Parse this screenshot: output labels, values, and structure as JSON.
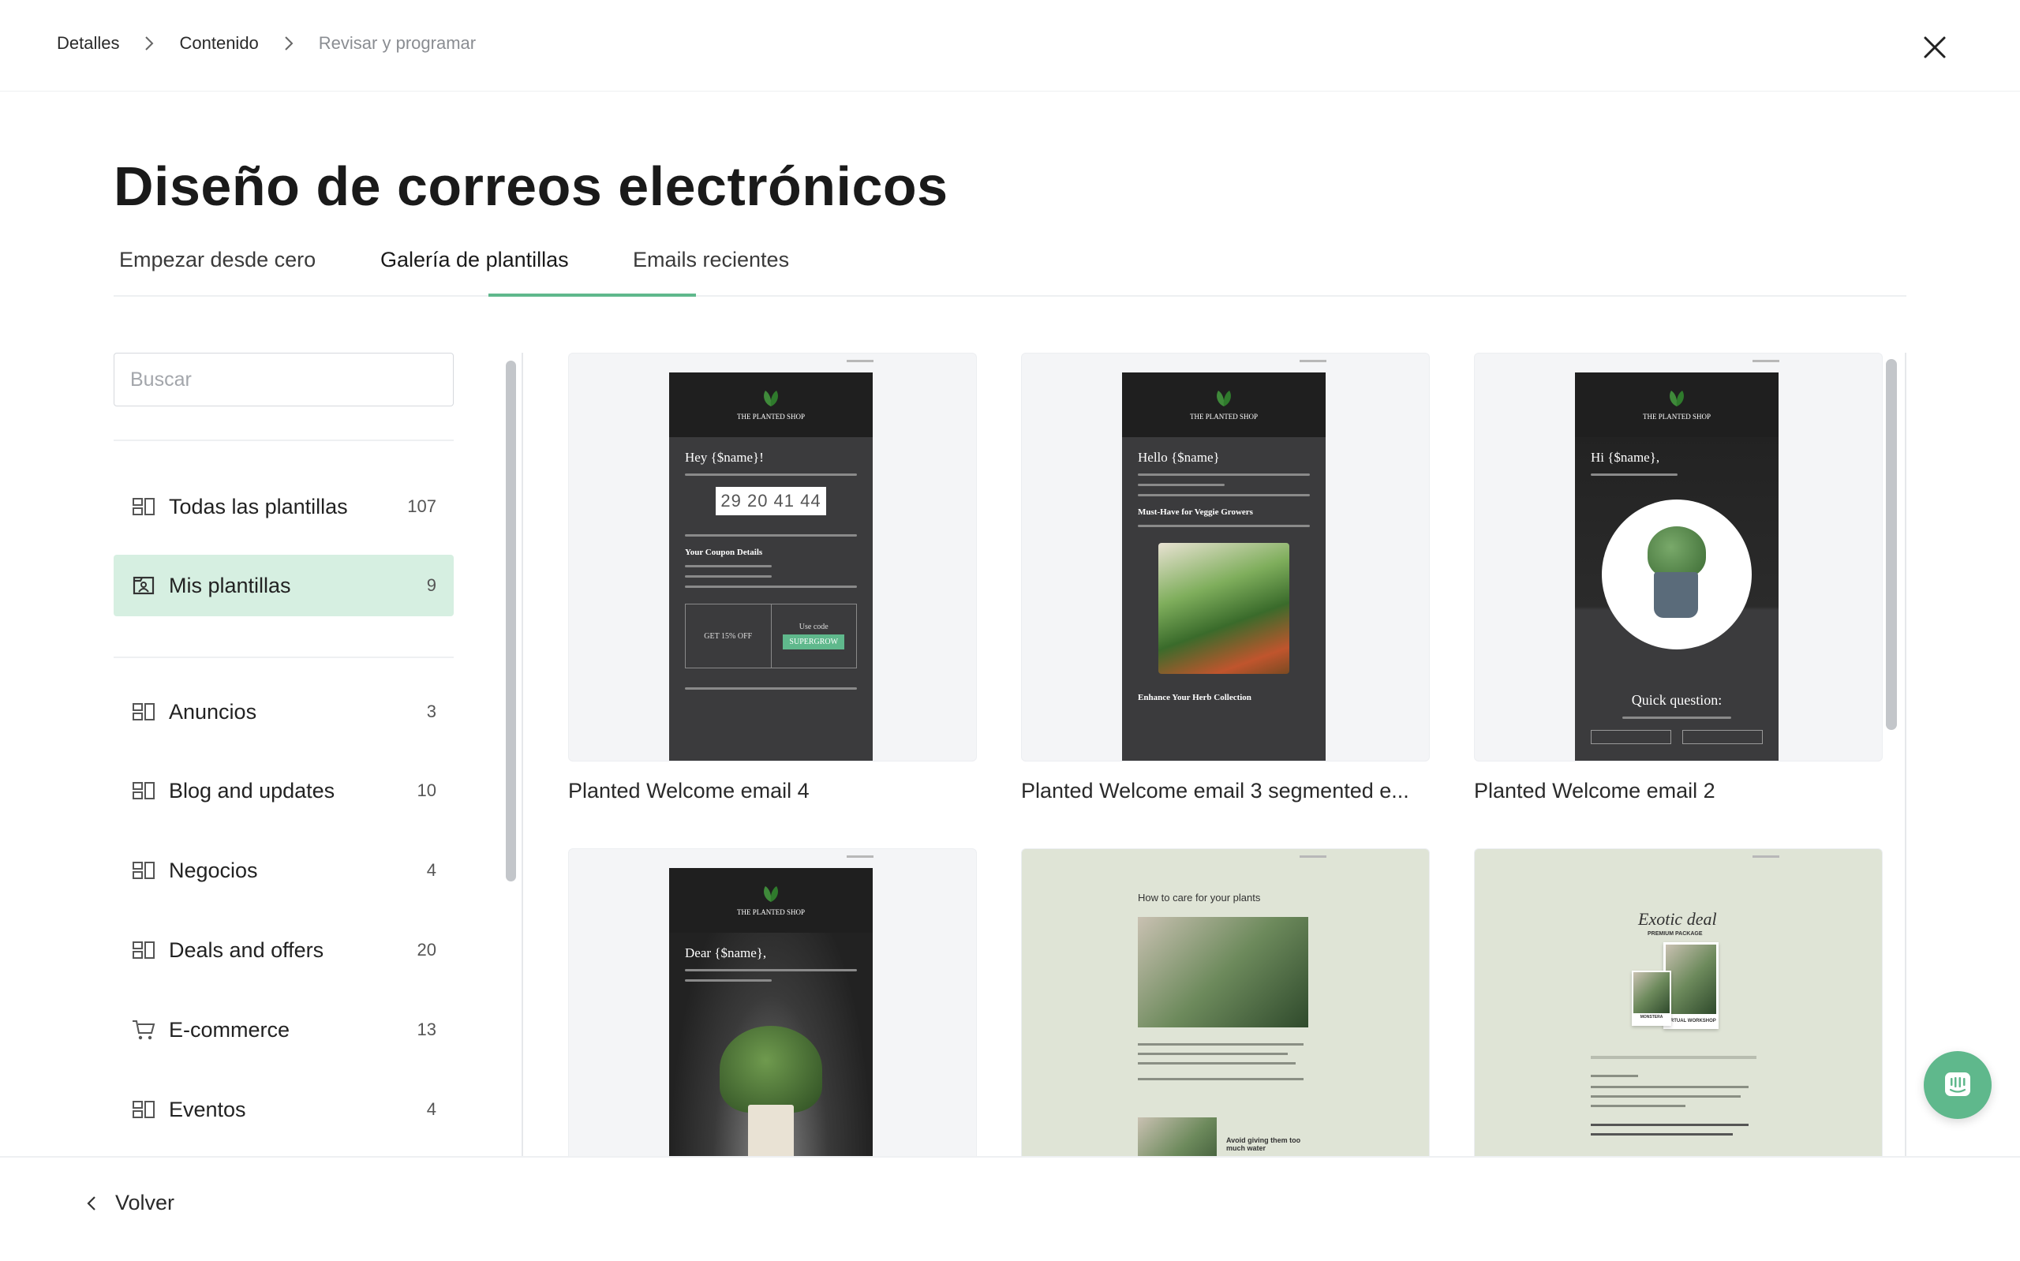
{
  "breadcrumb": {
    "step1": "Detalles",
    "step2": "Contenido",
    "step3": "Revisar y programar"
  },
  "page": {
    "title": "Diseño de correos electrónicos"
  },
  "tabs": [
    {
      "label": "Empezar desde cero",
      "active": false
    },
    {
      "label": "Galería de plantillas",
      "active": true
    },
    {
      "label": "Emails recientes",
      "active": false
    }
  ],
  "search": {
    "placeholder": "Buscar",
    "value": ""
  },
  "categories_primary": [
    {
      "label": "Todas las plantillas",
      "count": "107",
      "icon": "template-icon",
      "active": false
    },
    {
      "label": "Mis plantillas",
      "count": "9",
      "icon": "my-templates-icon",
      "active": true
    }
  ],
  "categories": [
    {
      "label": "Anuncios",
      "count": "3",
      "icon": "template-icon"
    },
    {
      "label": "Blog and updates",
      "count": "10",
      "icon": "template-icon"
    },
    {
      "label": "Negocios",
      "count": "4",
      "icon": "template-icon"
    },
    {
      "label": "Deals and offers",
      "count": "20",
      "icon": "template-icon"
    },
    {
      "label": "E-commerce",
      "count": "13",
      "icon": "cart-icon"
    },
    {
      "label": "Eventos",
      "count": "4",
      "icon": "template-icon"
    }
  ],
  "templates": [
    {
      "title": "Planted Welcome email 4",
      "preview": {
        "brand": "THE PLANTED SHOP",
        "greeting": "Hey {$name}!",
        "timer": "29 20 41 44",
        "section": "Your Coupon Details",
        "discount": "GET 15% OFF",
        "use_code": "Use code",
        "code": "SUPERGROW"
      }
    },
    {
      "title": "Planted Welcome email 3 segmented e...",
      "preview": {
        "brand": "THE PLANTED SHOP",
        "greeting": "Hello {$name}",
        "section": "Must-Have for Veggie Growers",
        "footer": "Enhance Your Herb Collection"
      }
    },
    {
      "title": "Planted Welcome email 2",
      "preview": {
        "brand": "THE PLANTED SHOP",
        "greeting": "Hi {$name},",
        "section": "Quick question:"
      }
    },
    {
      "title": "",
      "preview": {
        "brand": "THE PLANTED SHOP",
        "greeting": "Dear {$name},"
      }
    },
    {
      "title": "",
      "preview": {
        "heading": "How to care for your plants",
        "tip": "Avoid giving them too much water"
      }
    },
    {
      "title": "",
      "preview": {
        "script": "Exotic deal",
        "package": "PREMIUM PACKAGE",
        "workshop": "VIRTUAL WORKSHOP",
        "plant": "MONSTERA"
      }
    }
  ],
  "footer": {
    "back_label": "Volver"
  },
  "colors": {
    "accent": "#5fb88c",
    "active_bg": "#d6efe1",
    "email_dark": "#3b3b3d"
  }
}
